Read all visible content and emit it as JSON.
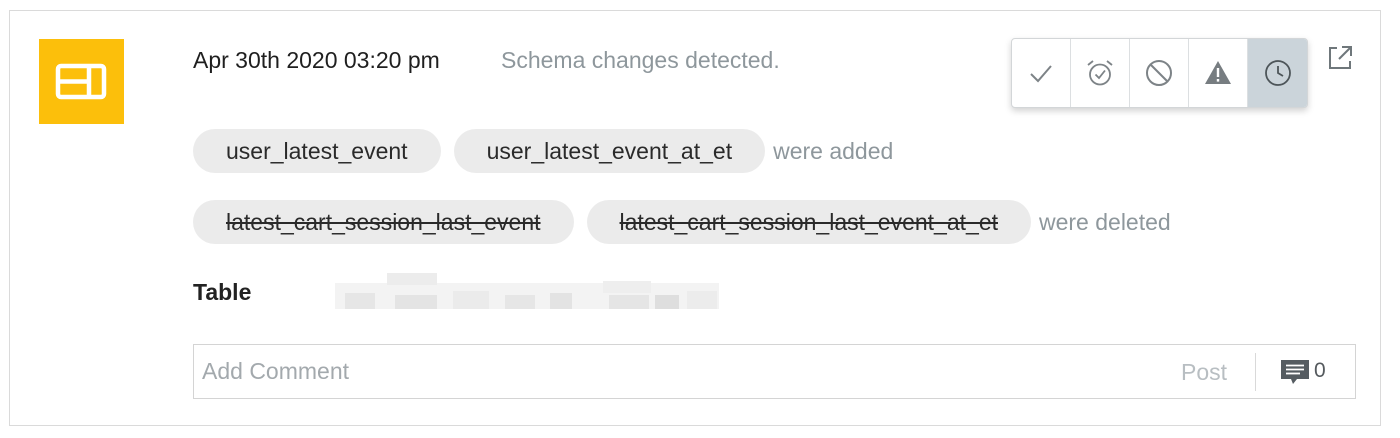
{
  "event": {
    "timestamp": "Apr 30th 2020 03:20 pm",
    "title": "Schema changes detected.",
    "icon": "table-icon",
    "accent_color": "#fcbf0b"
  },
  "status_actions": [
    {
      "icon": "check-icon",
      "active": false
    },
    {
      "icon": "snooze-alarm-icon",
      "active": false
    },
    {
      "icon": "block-icon",
      "active": false
    },
    {
      "icon": "warning-icon",
      "active": false
    },
    {
      "icon": "clock-icon",
      "active": true
    }
  ],
  "status_active_color": "#cbd4da",
  "external_link_icon": "external-link-icon",
  "changes": {
    "added": {
      "columns": [
        "user_latest_event",
        "user_latest_event_at_et"
      ],
      "suffix": "were added"
    },
    "deleted": {
      "columns": [
        "latest_cart_session_last_event",
        "latest_cart_session_last_event_at_et"
      ],
      "suffix": "were deleted"
    }
  },
  "table": {
    "label": "Table"
  },
  "comment": {
    "placeholder": "Add Comment",
    "post_label": "Post",
    "count": "0",
    "icon": "comment-icon"
  }
}
